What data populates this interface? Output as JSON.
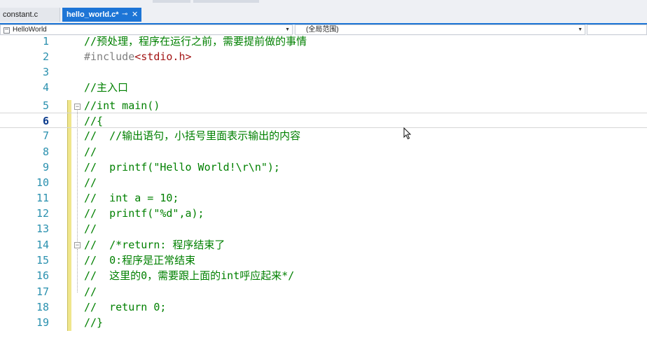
{
  "tabs": [
    {
      "label": "constant.c",
      "active": false
    },
    {
      "label": "hello_world.c*",
      "active": true,
      "pin": "⊸",
      "close": "✕"
    }
  ],
  "navbar": {
    "project": "HelloWorld",
    "scope": "(全局范围)",
    "member": ""
  },
  "editor": {
    "current_line": 6,
    "lines": [
      {
        "n": "1",
        "code": "//预处理，程序在运行之前，需要提前做的事情"
      },
      {
        "n": "2",
        "code": "#include<stdio.h>"
      },
      {
        "n": "3",
        "code": ""
      },
      {
        "n": "4",
        "code": "//主入口"
      },
      {
        "n": "5",
        "code": "//int main()"
      },
      {
        "n": "6",
        "code": "//{"
      },
      {
        "n": "7",
        "code": "//  //输出语句，小括号里面表示输出的内容"
      },
      {
        "n": "8",
        "code": "//"
      },
      {
        "n": "9",
        "code": "//  printf(\"Hello World!\\r\\n\");"
      },
      {
        "n": "10",
        "code": "//"
      },
      {
        "n": "11",
        "code": "//  int a = 10;"
      },
      {
        "n": "12",
        "code": "//  printf(\"%d\",a);"
      },
      {
        "n": "13",
        "code": "//"
      },
      {
        "n": "14",
        "code": "//  /*return: 程序结束了"
      },
      {
        "n": "15",
        "code": "//  0:程序是正常结束"
      },
      {
        "n": "16",
        "code": "//  这里的0，需要跟上面的int呼应起来*/"
      },
      {
        "n": "17",
        "code": "//"
      },
      {
        "n": "18",
        "code": "//  return 0;"
      },
      {
        "n": "19",
        "code": "//}"
      }
    ],
    "include_keyword": "#include",
    "include_target": "<stdio.h>"
  },
  "colors": {
    "accent": "#1d75d6",
    "comment": "#008000",
    "line_number": "#2b91af",
    "preprocessor": "#808080",
    "string_include": "#a31515",
    "change_bar": "#f0e68c"
  },
  "icons": {
    "project": "project-icon",
    "dropdown": "chevron-down-icon",
    "fold": "fold-collapse-icon",
    "cursor": "mouse-pointer-icon"
  }
}
